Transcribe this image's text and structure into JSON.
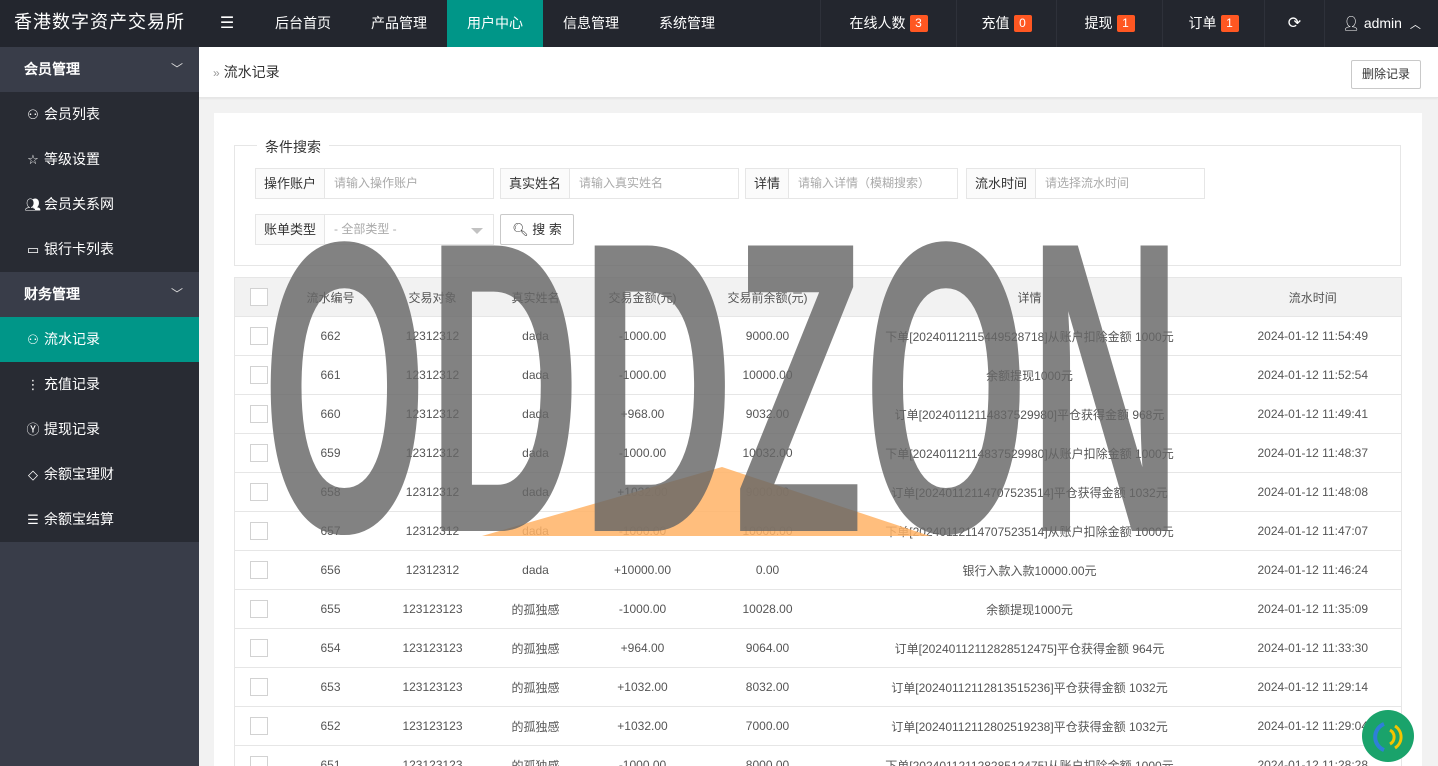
{
  "header": {
    "logo": "香港数字资产交易所",
    "fold_icon": "menu-fold-icon",
    "nav": [
      "后台首页",
      "产品管理",
      "用户中心",
      "信息管理",
      "系统管理"
    ],
    "active_nav": "用户中心",
    "stats": [
      {
        "label": "在线人数",
        "count": "3"
      },
      {
        "label": "充值",
        "count": "0"
      },
      {
        "label": "提现",
        "count": "1"
      },
      {
        "label": "订单",
        "count": "1"
      }
    ],
    "refresh_icon": "refresh-icon",
    "user": "admin"
  },
  "sidebar": {
    "groups": [
      {
        "label": "会员管理",
        "items": [
          {
            "label": "会员列表",
            "icon": "user-icon"
          },
          {
            "label": "等级设置",
            "icon": "star-icon"
          },
          {
            "label": "会员关系网",
            "icon": "users-icon"
          },
          {
            "label": "银行卡列表",
            "icon": "card-icon"
          }
        ]
      },
      {
        "label": "财务管理",
        "items": [
          {
            "label": "流水记录",
            "icon": "user-icon",
            "active": true
          },
          {
            "label": "充值记录",
            "icon": "more-vertical-icon"
          },
          {
            "label": "提现记录",
            "icon": "yen-icon"
          },
          {
            "label": "余额宝理财",
            "icon": "diamond-icon"
          },
          {
            "label": "余额宝结算",
            "icon": "list-icon"
          }
        ]
      }
    ]
  },
  "breadcrumb": {
    "title": "流水记录"
  },
  "toolbar": {
    "delete_label": "删除记录"
  },
  "search": {
    "legend": "条件搜索",
    "fields": [
      {
        "label": "操作账户",
        "placeholder": "请输入操作账户"
      },
      {
        "label": "真实姓名",
        "placeholder": "请输入真实姓名"
      },
      {
        "label": "详情",
        "placeholder": "请输入详情（模糊搜索）"
      },
      {
        "label": "流水时间",
        "placeholder": "请选择流水时间"
      }
    ],
    "type_label": "账单类型",
    "type_value": "- 全部类型 -",
    "button": "搜 索"
  },
  "table": {
    "columns": [
      "流水编号",
      "交易对象",
      "真实姓名",
      "交易金额(元)",
      "交易前余额(元)",
      "详情",
      "流水时间"
    ],
    "rows": [
      [
        "662",
        "12312312",
        "dada",
        "-1000.00",
        "9000.00",
        "下单[2024011211544952871​8]从账户扣除金额 1000元",
        "2024-01-12 11:54:49"
      ],
      [
        "661",
        "12312312",
        "dada",
        "-1000.00",
        "10000.00",
        "余额提现1000元",
        "2024-01-12 11:52:54"
      ],
      [
        "660",
        "12312312",
        "dada",
        "+968.00",
        "9032.00",
        "订单[20240112114837529980]平仓获得金额 968元",
        "2024-01-12 11:49:41"
      ],
      [
        "659",
        "12312312",
        "dada",
        "-1000.00",
        "10032.00",
        "下单[20240112114837529980]从账户扣除金额 1000元",
        "2024-01-12 11:48:37"
      ],
      [
        "658",
        "12312312",
        "dada",
        "+1032.00",
        "9000.00",
        "订单[20240112114707523514]平仓获得金额 1032元",
        "2024-01-12 11:48:08"
      ],
      [
        "657",
        "12312312",
        "dada",
        "-1000.00",
        "10000.00",
        "下单[20240112114707523514]从账户扣除金额 1000元",
        "2024-01-12 11:47:07"
      ],
      [
        "656",
        "12312312",
        "dada",
        "+10000.00",
        "0.00",
        "银行入款入款10000.00元",
        "2024-01-12 11:46:24"
      ],
      [
        "655",
        "123123123",
        "的孤独感",
        "-1000.00",
        "10028.00",
        "余额提现1000元",
        "2024-01-12 11:35:09"
      ],
      [
        "654",
        "123123123",
        "的孤独感",
        "+964.00",
        "9064.00",
        "订单[20240112112828512475]平仓获得金额 964元",
        "2024-01-12 11:33:30"
      ],
      [
        "653",
        "123123123",
        "的孤独感",
        "+1032.00",
        "8032.00",
        "订单[20240112112813515236]平仓获得金额 1032元",
        "2024-01-12 11:29:14"
      ],
      [
        "652",
        "123123123",
        "的孤独感",
        "+1032.00",
        "7000.00",
        "订单[20240112112802519238]平仓获得金额 1032元",
        "2024-01-12 11:29:04"
      ],
      [
        "651",
        "123123123",
        "的孤独感",
        "-1000.00",
        "8000.00",
        "下单[20240112112828512475]从账户扣除金额 1000元",
        "2024-01-12 11:28:28"
      ]
    ]
  },
  "watermark": {
    "text": "ODDZON"
  },
  "colors": {
    "header_bg": "#23262e",
    "sidebar_bg": "#393d49",
    "accent": "#009688",
    "badge": "#ff5722",
    "negative": "#ff0000",
    "positive": "#009900",
    "watermark": "#666666",
    "watermark_roof": "#ffb366"
  }
}
